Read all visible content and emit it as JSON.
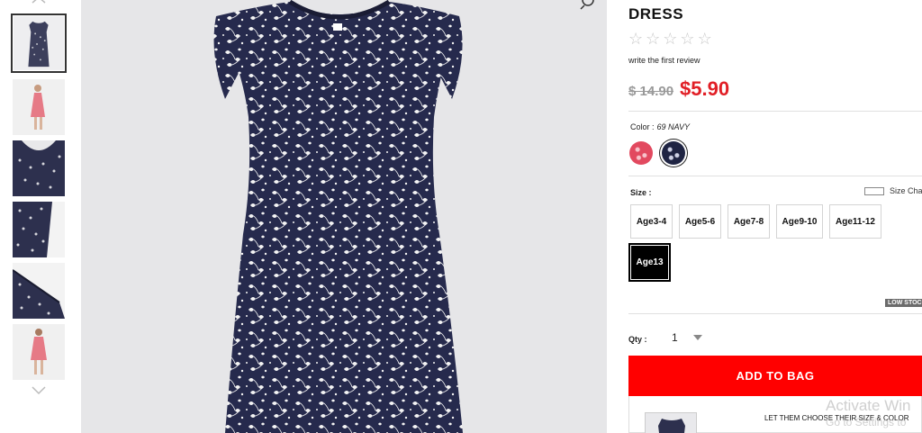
{
  "product": {
    "title": "DRESS",
    "review_link": "write the first review",
    "price_original": "$ 14.90",
    "price_sale": "$5.90",
    "rating_stars": 0
  },
  "color": {
    "label": "Color :",
    "selected_value": "69 NAVY",
    "swatches": [
      {
        "name": "pink floral",
        "color": "#e2495f",
        "selected": false
      },
      {
        "name": "navy floral",
        "color": "#1f2443",
        "selected": true
      }
    ]
  },
  "size": {
    "label": "Size :",
    "chart_label": "Size Cha",
    "options": [
      "Age3-4",
      "Age5-6",
      "Age7-8",
      "Age9-10",
      "Age11-12",
      "Age13"
    ],
    "selected": "Age13",
    "stock_badge": "LOW STOCK"
  },
  "quantity": {
    "label": "Qty :",
    "value": "1"
  },
  "add_to_bag_label": "ADD TO BAG",
  "promo_text": "LET THEM CHOOSE THEIR SIZE & COLOR",
  "watermark": {
    "line1": "Activate Win",
    "line2": "Go to Settings to"
  },
  "colors": {
    "accent_red": "#ff0000",
    "sale_price": "#e11f26",
    "dress_navy": "#23264a"
  },
  "icons": [
    "chevron-up-icon",
    "chevron-down-icon",
    "zoom-icon",
    "star-icon",
    "ruler-icon",
    "caret-down-icon"
  ]
}
